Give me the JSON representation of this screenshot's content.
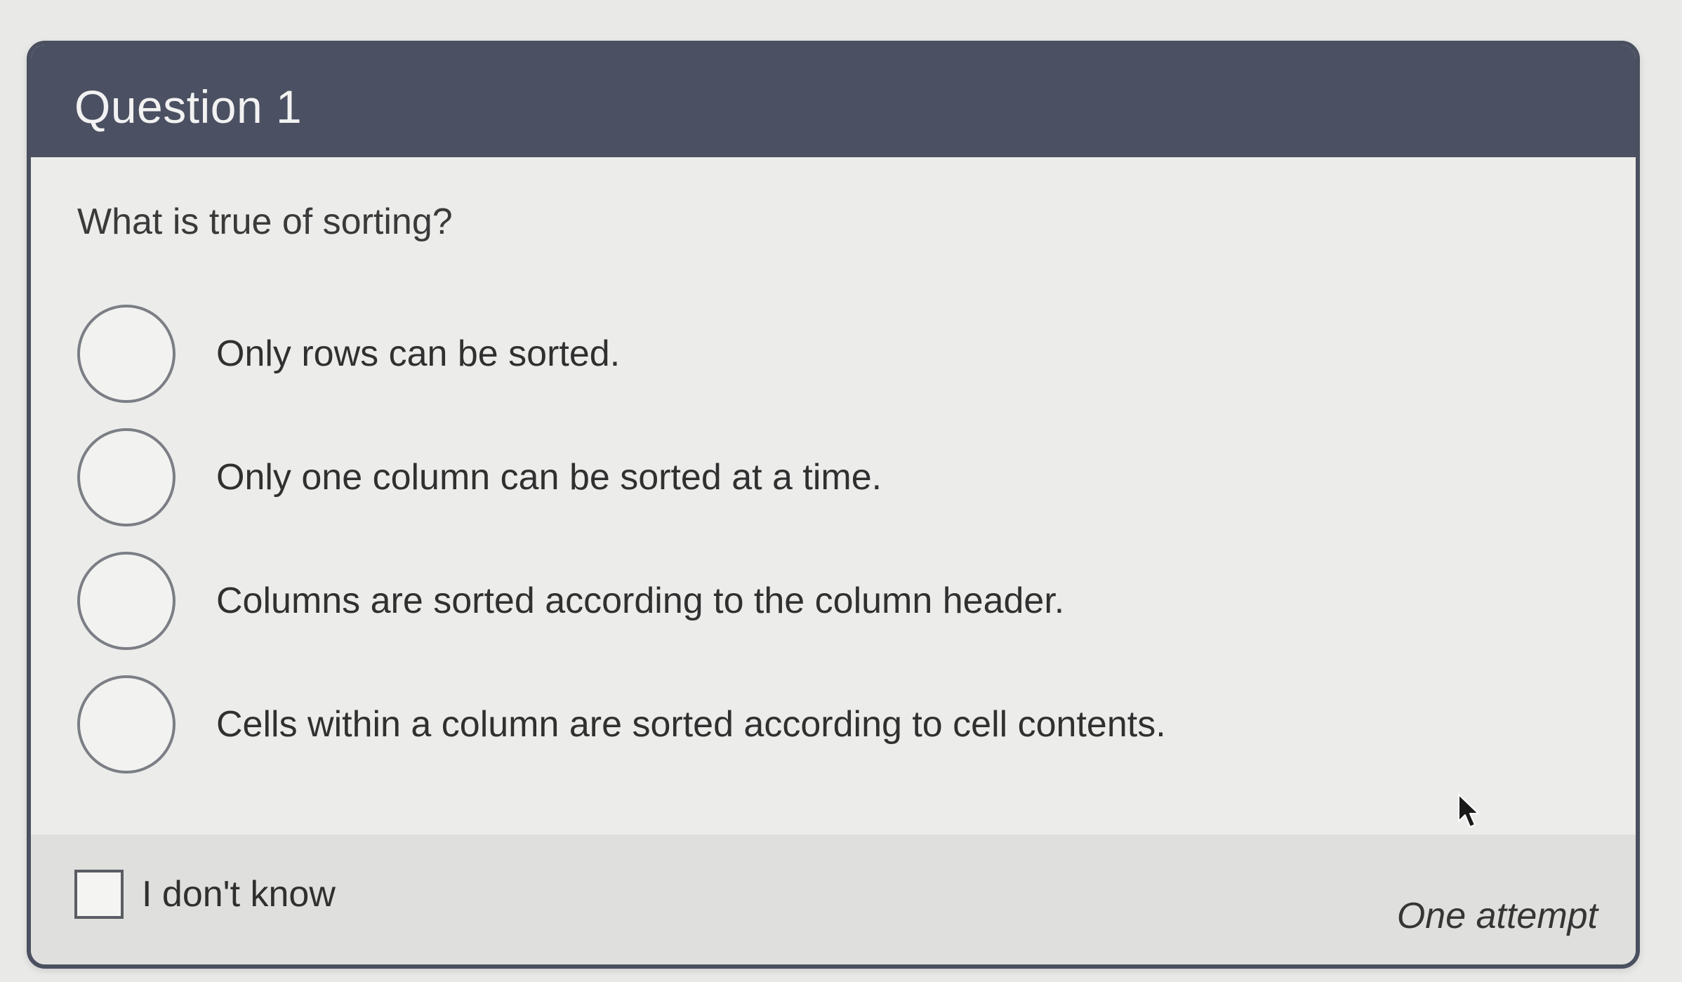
{
  "header": {
    "title": "Question 1"
  },
  "question": {
    "text": "What is true of sorting?"
  },
  "options": [
    {
      "label": "Only rows can be sorted."
    },
    {
      "label": "Only one column can be sorted at a time."
    },
    {
      "label": "Columns are sorted according to the column header."
    },
    {
      "label": "Cells within a column are sorted according to cell contents."
    }
  ],
  "footer": {
    "idk_label": "I don't know",
    "attempts_text": "One attempt"
  },
  "colors": {
    "header_bg": "#4b5062",
    "card_bg": "#ecedeb",
    "footer_bg": "#dfdfdd",
    "radio_border": "#7b7e84"
  },
  "icons": {
    "radio": "radio-circle",
    "checkbox": "checkbox-square",
    "cursor": "mouse-pointer"
  }
}
